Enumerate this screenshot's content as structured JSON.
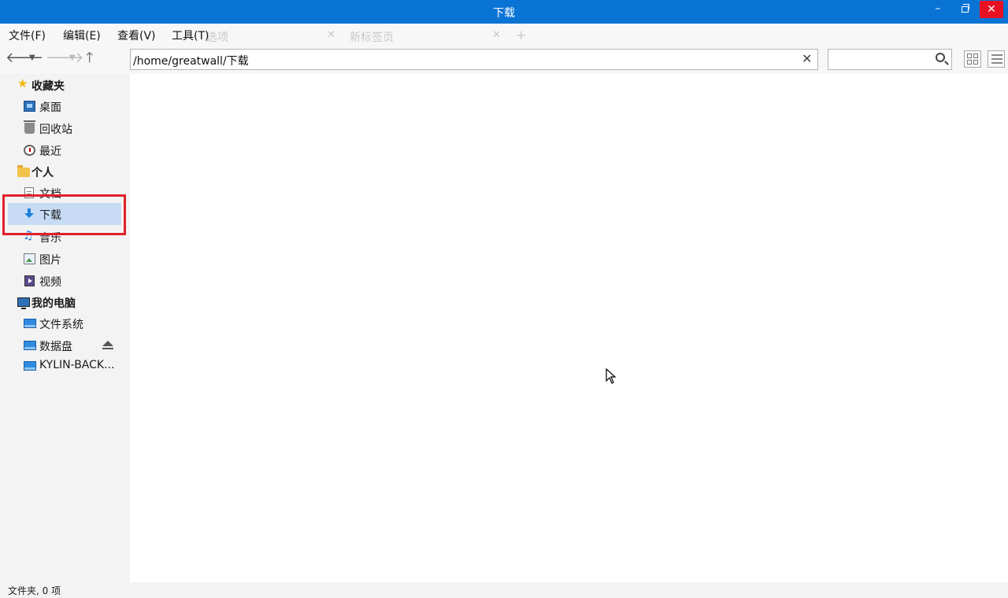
{
  "window": {
    "title": "下载",
    "controls": {
      "minimize": "–",
      "close": "✕"
    }
  },
  "menubar": {
    "items": [
      "文件(F)",
      "编辑(E)",
      "查看(V)",
      "工具(T)"
    ],
    "background_ghost_tabs": [
      "选项",
      "新标签页"
    ]
  },
  "toolbar": {
    "path": "/home/greatwall/下载",
    "search_value": "",
    "icons": [
      "back-icon",
      "dropdown-icon",
      "forward-icon",
      "dropdown-icon",
      "up-icon",
      "clear-icon",
      "search-icon",
      "icon-view-icon",
      "detail-view-icon"
    ]
  },
  "sidebar": {
    "favorites": {
      "label": "收藏夹",
      "items": [
        {
          "label": "桌面",
          "icon": "desktop-icon"
        },
        {
          "label": "回收站",
          "icon": "trash-icon"
        },
        {
          "label": "最近",
          "icon": "clock-icon"
        }
      ]
    },
    "personal": {
      "label": "个人",
      "items": [
        {
          "label": "文档",
          "icon": "document-icon"
        },
        {
          "label": "下载",
          "icon": "download-icon",
          "selected": true
        },
        {
          "label": "音乐",
          "icon": "music-icon"
        },
        {
          "label": "图片",
          "icon": "image-icon"
        },
        {
          "label": "视频",
          "icon": "video-icon"
        }
      ]
    },
    "computer": {
      "label": "我的电脑",
      "items": [
        {
          "label": "文件系统",
          "icon": "drive-icon"
        },
        {
          "label": "数据盘",
          "icon": "drive-icon",
          "eject": true
        },
        {
          "label": "KYLIN-BACK...",
          "icon": "drive-icon"
        }
      ]
    }
  },
  "statusbar": {
    "text": "文件夹, 0 项"
  },
  "colors": {
    "titlebar": "#0a74d4",
    "close_button": "#e81123",
    "selection": "#c7dcf4",
    "highlight_box": "#e0202a"
  }
}
